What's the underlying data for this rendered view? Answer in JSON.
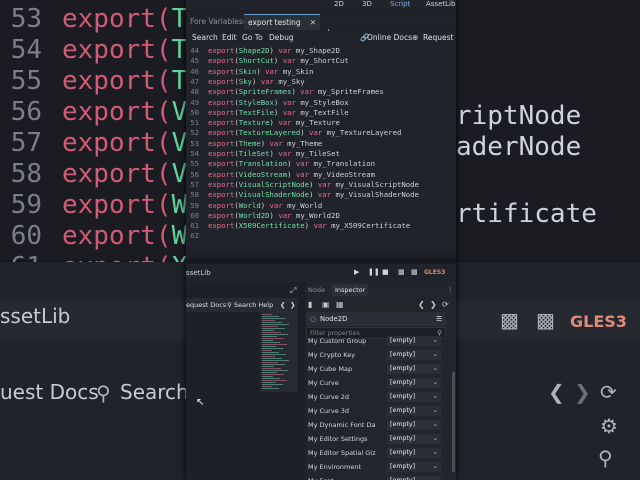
{
  "background": {
    "line_numbers": [
      "53",
      "54",
      "55",
      "56",
      "57",
      "58",
      "59",
      "60",
      "61",
      "62"
    ],
    "code_lines": [
      {
        "kw": "export(",
        "ty": "Theme"
      },
      {
        "kw": "export(",
        "ty": "TileSe"
      },
      {
        "kw": "export(",
        "ty": "Trans"
      },
      {
        "kw": "export(",
        "ty": "Video"
      },
      {
        "kw": "export(",
        "ty": "Visua"
      },
      {
        "kw": "export(",
        "ty": "Visua"
      },
      {
        "kw": "export(",
        "ty": "World"
      },
      {
        "kw": "export(",
        "ty": "World"
      },
      {
        "kw": "export(",
        "ty": "X509Ce"
      },
      {
        "kw": "",
        "ty": ""
      }
    ],
    "right_fragments": [
      "riptNode",
      "aderNode",
      "",
      "rtificate"
    ],
    "bottom_labels": [
      "ssetLib",
      "uest Docs",
      "Search H"
    ],
    "gles": "GLES3"
  },
  "topbar": {
    "view_2d": "2D",
    "view_3d": "3D",
    "view_script": "Script",
    "view_assetlib": "AssetLib"
  },
  "tabs": [
    {
      "label": "Fore Variables(*)",
      "active": false
    },
    {
      "label": "export testing",
      "active": true
    }
  ],
  "menu": {
    "search": "Search",
    "edit": "Edit",
    "goto": "Go To",
    "debug": "Debug",
    "online_docs": "Online Docs",
    "request_docs": "Request D"
  },
  "editor": {
    "lines": [
      {
        "n": "44",
        "type": "Shape2D",
        "var": "my_Shape2D"
      },
      {
        "n": "45",
        "type": "ShortCut",
        "var": "my_ShortCut"
      },
      {
        "n": "46",
        "type": "Skin",
        "var": "my_Skin"
      },
      {
        "n": "47",
        "type": "Sky",
        "var": "my_Sky"
      },
      {
        "n": "48",
        "type": "SpriteFrames",
        "var": "my_SpriteFrames"
      },
      {
        "n": "49",
        "type": "StyleBox",
        "var": "my_StyleBox"
      },
      {
        "n": "50",
        "type": "TextFile",
        "var": "my_TextFile"
      },
      {
        "n": "51",
        "type": "Texture",
        "var": "my_Texture"
      },
      {
        "n": "52",
        "type": "TextureLayered",
        "var": "my_TextureLayered"
      },
      {
        "n": "53",
        "type": "Theme",
        "var": "my_Theme"
      },
      {
        "n": "54",
        "type": "TileSet",
        "var": "my_TileSet"
      },
      {
        "n": "55",
        "type": "Translation",
        "var": "my_Translation"
      },
      {
        "n": "56",
        "type": "VideoStream",
        "var": "my_VideoStream"
      },
      {
        "n": "57",
        "type": "VisualScriptNode",
        "var": "my_VisualScriptNode"
      },
      {
        "n": "58",
        "type": "VisualShaderNode",
        "var": "my_VisualShaderNode"
      },
      {
        "n": "59",
        "type": "World",
        "var": "my_World"
      },
      {
        "n": "60",
        "type": "World2D",
        "var": "my_World2D"
      },
      {
        "n": "61",
        "type": "X509Certificate",
        "var": "my_X509Certificate"
      },
      {
        "n": "62",
        "type": "",
        "var": ""
      }
    ],
    "kw_export": "export",
    "kw_var": "var"
  },
  "bottom": {
    "assetlib": "ssetLib",
    "gles": "GLES3"
  },
  "left_tools": {
    "request_docs": "equest Docs",
    "search_help": "Search Help"
  },
  "inspector": {
    "tab_node": "Node",
    "tab_inspector": "Inspector",
    "node_name": "Node2D",
    "filter_placeholder": "Filter properties",
    "properties": [
      {
        "name": "My Custom Group",
        "value": "[empty]"
      },
      {
        "name": "My Crypto Key",
        "value": "[empty]"
      },
      {
        "name": "My Cube Map",
        "value": "[empty]"
      },
      {
        "name": "My Curve",
        "value": "[empty]"
      },
      {
        "name": "My Curve 2d",
        "value": "[empty]"
      },
      {
        "name": "My Curve 3d",
        "value": "[empty]"
      },
      {
        "name": "My Dynamic Font Dat",
        "value": "[empty]"
      },
      {
        "name": "My Editor Settings",
        "value": "[empty]"
      },
      {
        "name": "My Editor Spatial Giz",
        "value": "[empty]"
      },
      {
        "name": "My Environment",
        "value": "[empty]"
      },
      {
        "name": "My Font",
        "value": "[empty]"
      }
    ]
  }
}
